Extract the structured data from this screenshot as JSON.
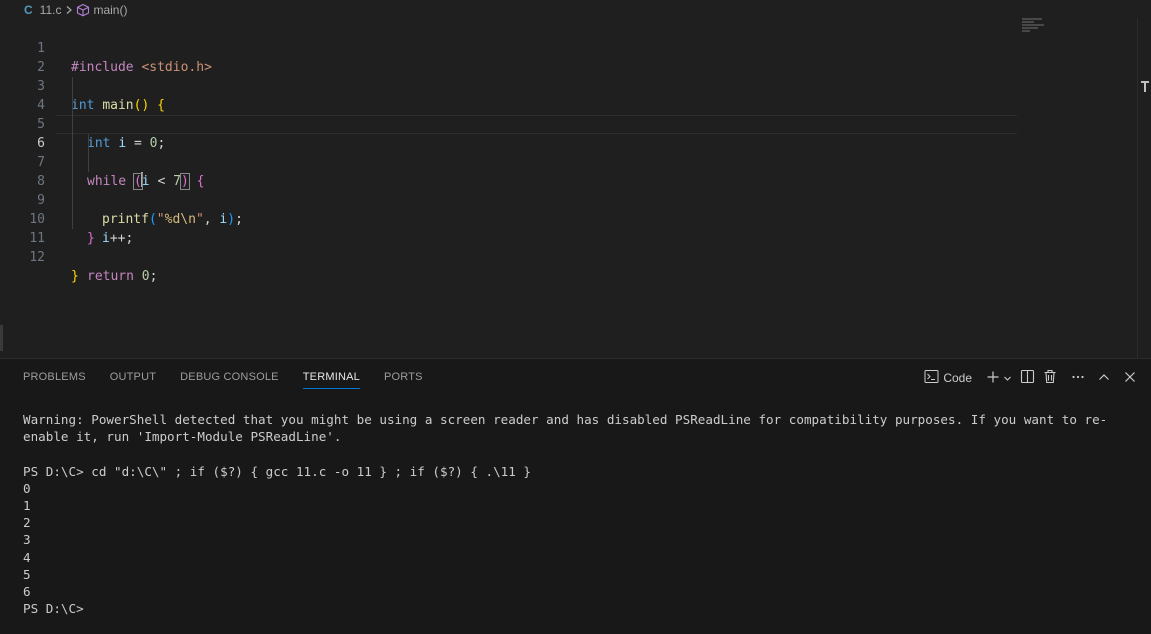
{
  "breadcrumb": {
    "file_icon": "C",
    "file": "11.c",
    "symbol": "main()"
  },
  "editor": {
    "current_line": 6,
    "lines": [
      {
        "n": "1"
      },
      {
        "n": "2"
      },
      {
        "n": "3"
      },
      {
        "n": "4"
      },
      {
        "n": "5"
      },
      {
        "n": "6"
      },
      {
        "n": "7"
      },
      {
        "n": "8"
      },
      {
        "n": "9"
      },
      {
        "n": "10"
      },
      {
        "n": "11"
      },
      {
        "n": "12"
      }
    ],
    "code": {
      "l1_pre": "#include",
      "l1_inc": " <stdio.h>",
      "l3_kw": "int",
      "l3_fn": "main",
      "l4_kw": "int",
      "l4_var": "i",
      "l4_eq": " = ",
      "l4_num": "0",
      "l6_kw": "while",
      "l6_var": "i",
      "l6_op": " < ",
      "l6_num": "7",
      "l7_fn": "printf",
      "l7_str1": "\"",
      "l7_fmt": "%d",
      "l7_esc": "\\n",
      "l7_str2": "\"",
      "l7_var": "i",
      "l8_var": "i",
      "l8_op": "++",
      "l11_kw": "return",
      "l11_num": "0"
    }
  },
  "panel": {
    "tabs": [
      "PROBLEMS",
      "OUTPUT",
      "DEBUG CONSOLE",
      "TERMINAL",
      "PORTS"
    ],
    "active_tab": "TERMINAL",
    "terminal_label": "Code"
  },
  "terminal": {
    "lines": [
      "Warning: PowerShell detected that you might be using a screen reader and has disabled PSReadLine for compatibility purposes. If you want to re-enable it, run 'Import-Module PSReadLine'.",
      "",
      "PS D:\\C> cd \"d:\\C\\\" ; if ($?) { gcc 11.c -o 11 } ; if ($?) { .\\11 }",
      "0",
      "1",
      "2",
      "3",
      "4",
      "5",
      "6",
      "PS D:\\C>"
    ]
  },
  "colors": {
    "editor_bg": "#1f1f1f",
    "panel_bg": "#181818",
    "accent": "#0078d4",
    "keyword": "#569cd6",
    "control": "#c586c0",
    "function": "#dcdcaa",
    "variable": "#9cdcfe",
    "number": "#b5cea8",
    "string": "#ce9178"
  },
  "icons": {
    "breadcrumb_separator": "chevron-right-icon",
    "symbol": "cube-icon",
    "terminal_profile": "terminal-icon",
    "new_terminal": "plus-icon",
    "dropdown": "chevron-down-icon",
    "split": "split-icon",
    "kill": "trash-icon",
    "more": "ellipsis-icon",
    "maximize": "chevron-up-icon",
    "close": "close-icon"
  }
}
